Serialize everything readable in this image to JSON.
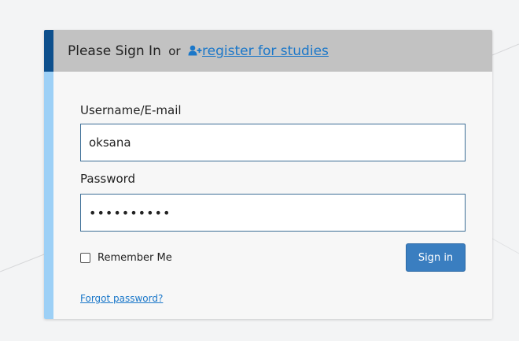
{
  "header": {
    "title": "Please Sign In",
    "or": "or",
    "register_link": "register for studies",
    "register_icon": "user-plus-icon"
  },
  "form": {
    "username_label": "Username/E-mail",
    "username_value": "oksana",
    "password_label": "Password",
    "password_value": "••••••••••",
    "remember_label": "Remember Me",
    "remember_checked": false,
    "signin_label": "Sign in",
    "forgot_link": "Forgot password?"
  },
  "colors": {
    "header_bg": "#c2c2c2",
    "header_accent": "#0d4f8c",
    "body_accent": "#9dd0f6",
    "link": "#1a77c9",
    "button": "#3a7ec0"
  }
}
